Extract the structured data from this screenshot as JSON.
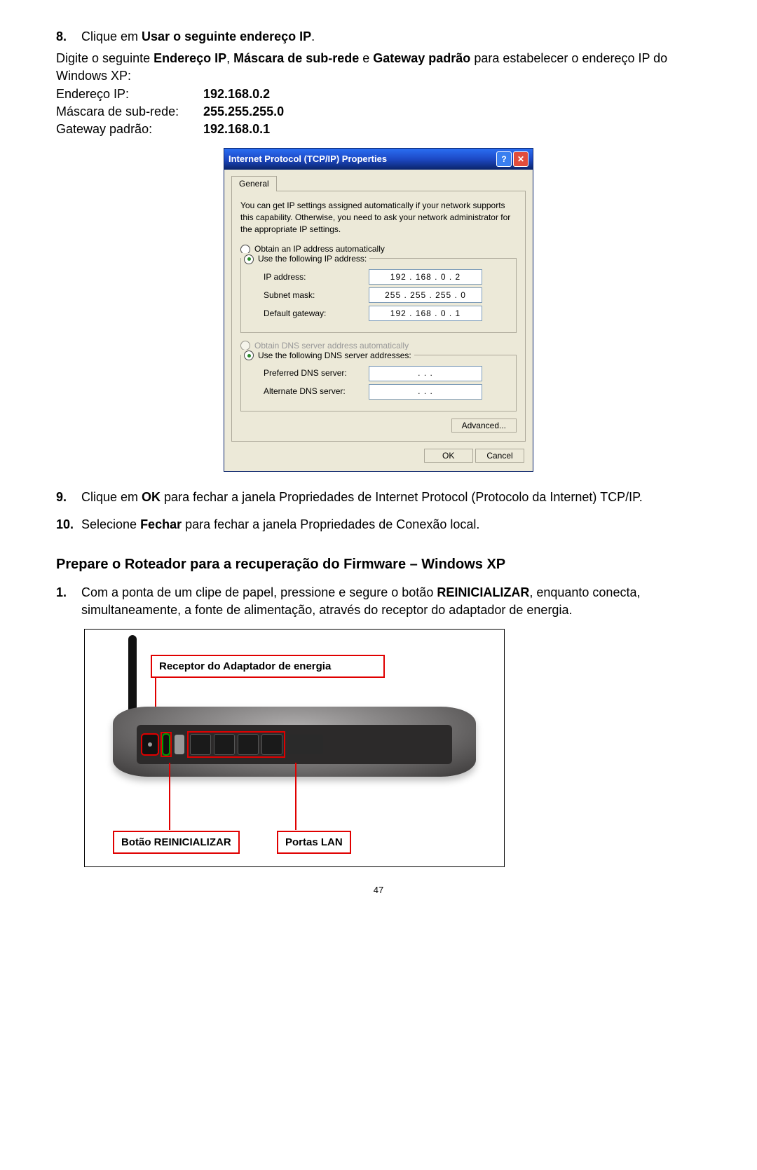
{
  "step8": {
    "num": "8.",
    "line1_pre": "Clique em ",
    "line1_bold": "Usar o seguinte endereço IP",
    "line1_post": "."
  },
  "para_after8": {
    "pre": "Digite o seguinte ",
    "b1": "Endereço IP",
    "mid1": ", ",
    "b2": "Máscara de sub-rede",
    "mid2": " e ",
    "b3": "Gateway padrão",
    "post": " para estabelecer o endereço IP do Windows XP:"
  },
  "kv": {
    "ip_label": "Endereço IP:",
    "ip_value": "192.168.0.2",
    "mask_label": "Máscara de sub-rede:",
    "mask_value": "255.255.255.0",
    "gw_label": "Gateway padrão:",
    "gw_value": "192.168.0.1"
  },
  "xp": {
    "title": "Internet Protocol (TCP/IP) Properties",
    "tab_general": "General",
    "desc": "You can get IP settings assigned automatically if your network supports this capability. Otherwise, you need to ask your network administrator for the appropriate IP settings.",
    "radio_obtain_ip": "Obtain an IP address automatically",
    "radio_use_ip": "Use the following IP address:",
    "lbl_ip": "IP address:",
    "lbl_subnet": "Subnet mask:",
    "lbl_gateway": "Default gateway:",
    "val_ip": "192 . 168 .  0  .  2",
    "val_subnet": "255 . 255 . 255 .  0",
    "val_gateway": "192 . 168 .  0  .  1",
    "radio_obtain_dns": "Obtain DNS server address automatically",
    "radio_use_dns": "Use the following DNS server addresses:",
    "lbl_pref_dns": "Preferred DNS server:",
    "lbl_alt_dns": "Alternate DNS server:",
    "val_empty_ip": ".      .      .",
    "btn_advanced": "Advanced...",
    "btn_ok": "OK",
    "btn_cancel": "Cancel",
    "help_glyph": "?",
    "close_glyph": "✕"
  },
  "step9": {
    "num": "9.",
    "pre": "Clique em ",
    "bold": "OK",
    "post": " para fechar a janela Propriedades de Internet Protocol (Protocolo da Internet) TCP/IP."
  },
  "step10": {
    "num": "10.",
    "pre": "Selecione ",
    "bold": "Fechar",
    "post": " para fechar a janela Propriedades de Conexão local."
  },
  "section_heading": "Prepare o Roteador para a recuperação do Firmware – Windows XP",
  "stepR1": {
    "num": "1.",
    "pre": "Com a ponta de um clipe de papel, pressione e segure o botão ",
    "bold": "REINICIALIZAR",
    "post": ", enquanto conecta, simultaneamente, a fonte de alimentação, através do receptor do adaptador de energia."
  },
  "router": {
    "callout_adapter": "Receptor do Adaptador de energia",
    "callout_reset": "Botão REINICIALIZAR",
    "callout_lan": "Portas LAN"
  },
  "page_number": "47"
}
